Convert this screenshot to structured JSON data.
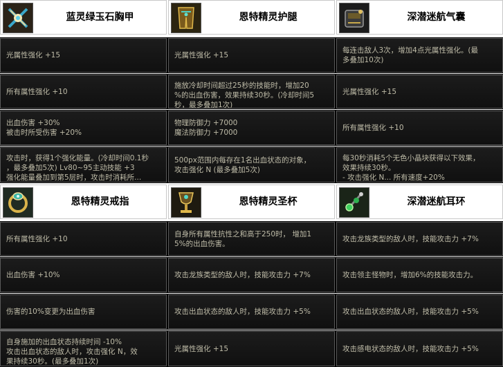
{
  "columns": [
    {
      "title": "蓝灵绿玉石胸甲",
      "icon": "chest-armor-icon",
      "rows": [
        [
          "光属性强化 +15"
        ],
        [
          "所有属性强化 +10"
        ],
        [
          "出血伤害 +30%",
          "被击时所受伤害 +20%"
        ],
        [
          "攻击时，获得1个强化能量。(冷却时间0.1秒",
          "，最多叠加5次)   Lv80~95主动技能 +3",
          "强化能量叠加到第5层时，攻击时消耗所..."
        ]
      ],
      "title2": "恩特精灵戒指",
      "icon2": "ring-icon",
      "rows2": [
        [
          "所有属性强化 +10"
        ],
        [
          "出血伤害 +10%"
        ],
        [
          "伤害的10%变更为出血伤害"
        ],
        [
          "自身施加的出血状态持续时间 -10%",
          "攻击出血状态的敌人时，攻击强化 N，效",
          "果持续30秒。(最多叠加1次)"
        ]
      ]
    },
    {
      "title": "恩特精灵护腿",
      "icon": "leg-armor-icon",
      "rows": [
        [
          "光属性强化 +15"
        ],
        [
          "施放冷却时间超过25秒的技能时，增加20",
          "%的出血伤害，效果持续30秒。(冷却时间5",
          "秒，最多叠加1次)"
        ],
        [
          "物理防御力 +7000",
          "魔法防御力 +7000"
        ],
        [
          "500px范围内每存在1名出血状态的对象，",
          "攻击强化 N (最多叠加5次)"
        ]
      ],
      "title2": "恩特精灵圣杯",
      "icon2": "chalice-icon",
      "rows2": [
        [
          "自身所有属性抗性之和高于250时， 增加1",
          "5%的出血伤害。"
        ],
        [
          "攻击龙族类型的敌人时，技能攻击力 +7%"
        ],
        [
          "攻击出血状态的敌人时，技能攻击力 +5%"
        ],
        [
          "光属性强化 +15"
        ]
      ]
    },
    {
      "title": "深潜迷航气囊",
      "icon": "airbag-icon",
      "rows": [
        [
          "每连击敌人3次，增加4点光属性强化。(最",
          "多叠加10次)"
        ],
        [
          "光属性强化 +15"
        ],
        [
          "所有属性强化 +10"
        ],
        [
          "每30秒消耗5个无色小晶块获得以下效果，",
          "效果持续30秒。",
          "- 攻击强化 N...  所有速度+20%"
        ]
      ],
      "title2": "深潜迷航耳环",
      "icon2": "earring-icon",
      "rows2": [
        [
          "攻击龙族类型的敌人时，技能攻击力 +7%"
        ],
        [
          "攻击领主怪物时，增加6%的技能攻击力。"
        ],
        [
          "攻击出血状态的敌人时，技能攻击力 +5%"
        ],
        [
          "攻击感电状态的敌人时，技能攻击力 +5%"
        ]
      ]
    }
  ],
  "colors": {
    "panel_text": "#bfbca8",
    "panel_bg": "#151515",
    "header_bg": "#ffffff"
  }
}
